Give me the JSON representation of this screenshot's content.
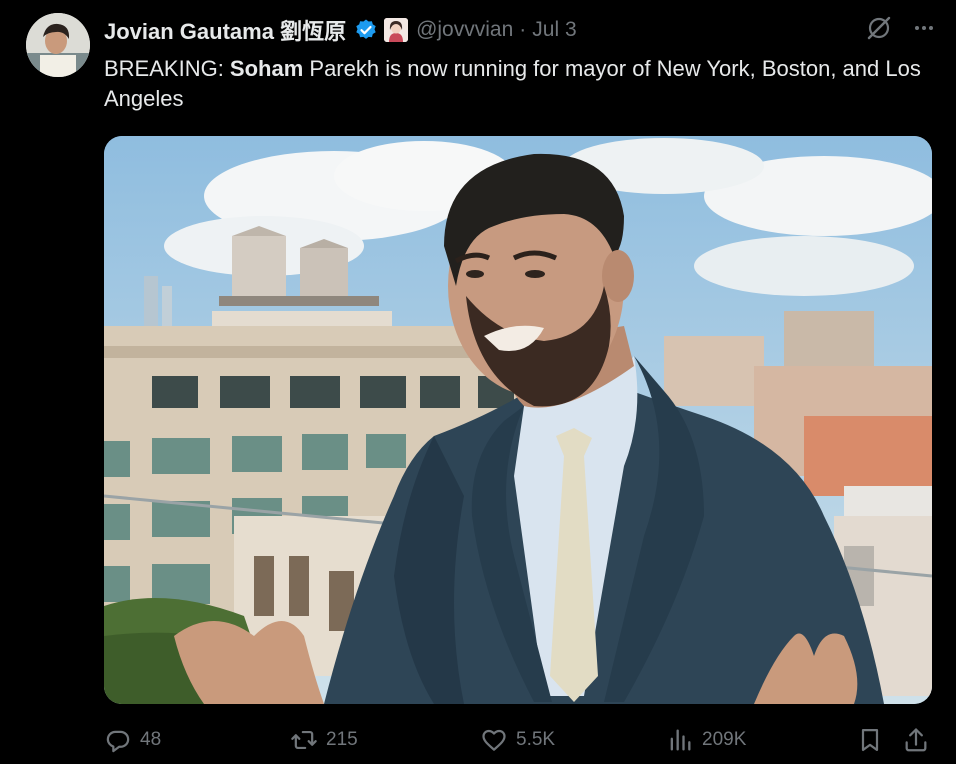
{
  "tweet": {
    "display_name": "Jovian Gautama 劉恆原",
    "handle": "@jovvvian",
    "separator": "·",
    "date": "Jul 3",
    "text_prefix": "BREAKING: ",
    "text_bold": "Soham",
    "text_suffix": " Parekh is now running for mayor of New York, Boston, and Los Angeles",
    "verified": true
  },
  "actions": {
    "replies": "48",
    "reposts": "215",
    "likes": "5.5K",
    "views": "209K"
  },
  "icons": {
    "reply": "reply-icon",
    "repost": "repost-icon",
    "like": "heart-icon",
    "views": "views-icon",
    "bookmark": "bookmark-icon",
    "share": "share-icon",
    "grok": "grok-icon",
    "more": "more-icon",
    "verified": "verified-badge-icon"
  },
  "colors": {
    "background": "#000000",
    "text": "#e7e9ea",
    "muted": "#71767b",
    "verified": "#1d9bf0"
  }
}
